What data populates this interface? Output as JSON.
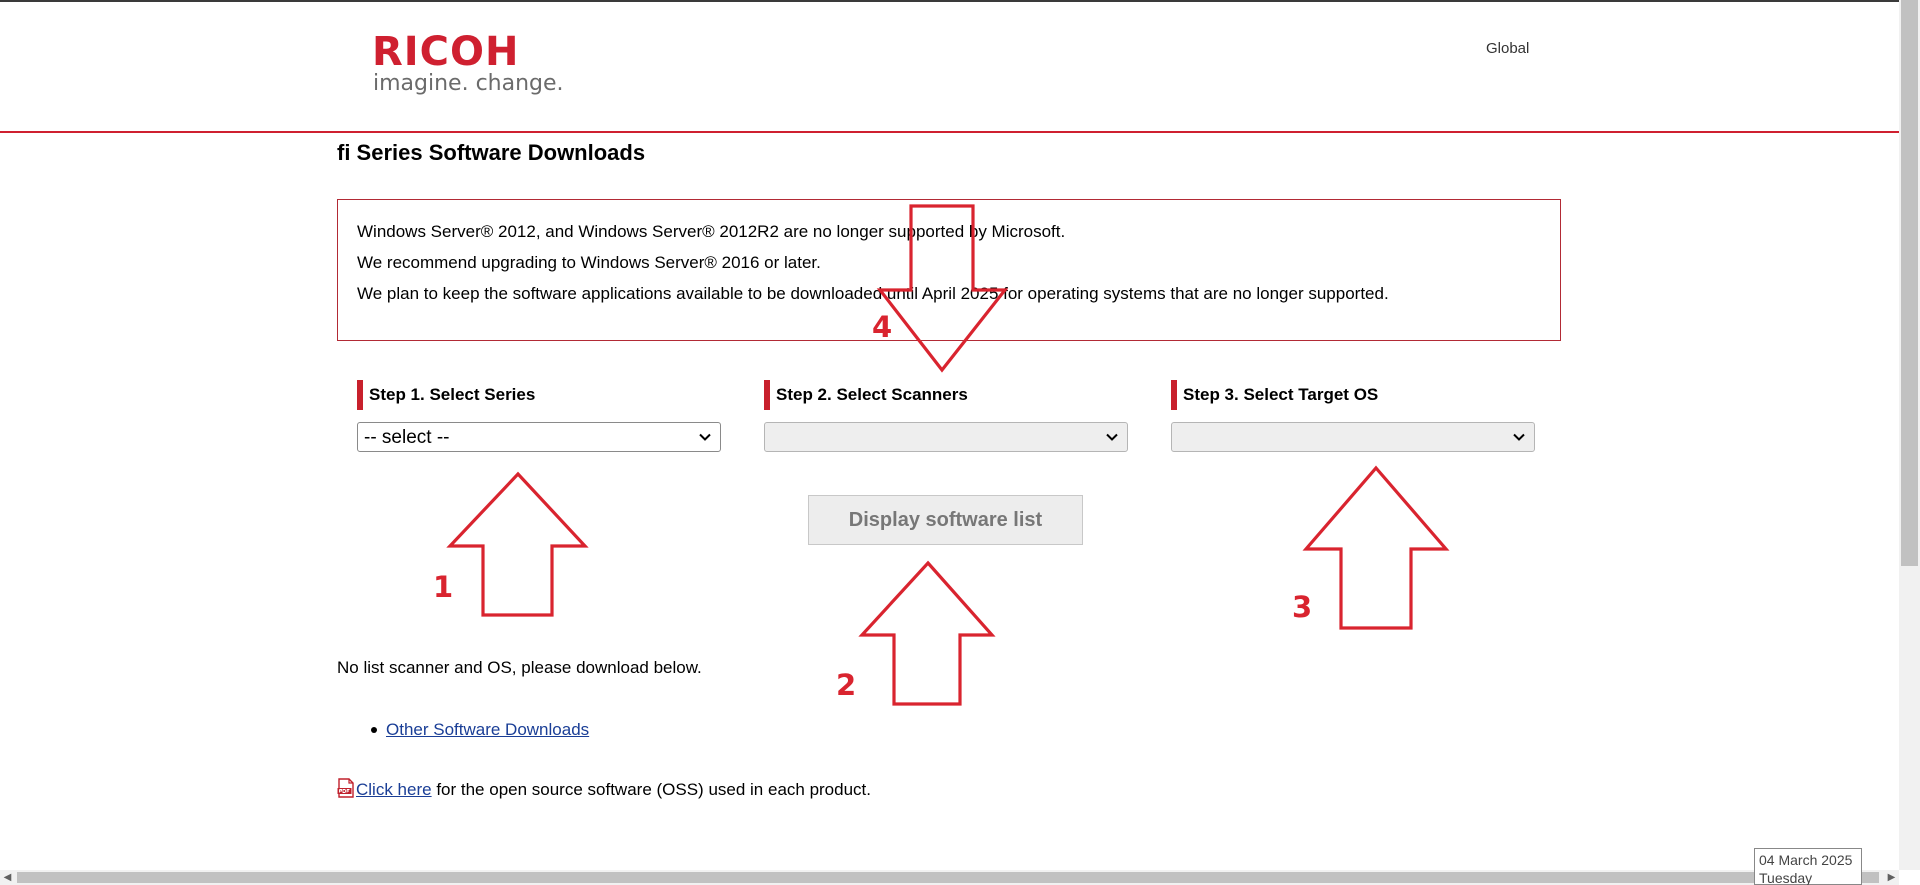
{
  "header": {
    "logo_word": "RICOH",
    "logo_tagline": "imagine. change.",
    "global_link": "Global"
  },
  "page_title": "fi Series Software Downloads",
  "notice": {
    "lines": [
      "Windows Server® 2012, and Windows Server® 2012R2 are no longer supported by Microsoft.",
      "We recommend upgrading to Windows Server® 2016 or later.",
      "We plan to keep the software applications available to be downloaded until April 2025 for operating systems that are no longer supported."
    ]
  },
  "steps": [
    {
      "label": "Step 1. Select Series",
      "selected_value": "-- select --",
      "enabled": true
    },
    {
      "label": "Step 2. Select Scanners",
      "selected_value": "",
      "enabled": false
    },
    {
      "label": "Step 3. Select Target OS",
      "selected_value": "",
      "enabled": false
    }
  ],
  "display_button_label": "Display software list",
  "no_list_text": "No list scanner and OS, please download below.",
  "links": {
    "other_downloads": "Other Software Downloads",
    "oss_link": "Click here",
    "oss_suffix": " for the open source software (OSS) used in each product."
  },
  "date_widget": {
    "date": "04 March 2025",
    "day": "Tuesday"
  },
  "annotations": {
    "numbers": [
      "1",
      "2",
      "3",
      "4"
    ],
    "color": "#d9242f"
  },
  "colors": {
    "brand_red": "#cf2030",
    "link_blue": "#1a3e96",
    "annotation_red": "#d9242f"
  }
}
